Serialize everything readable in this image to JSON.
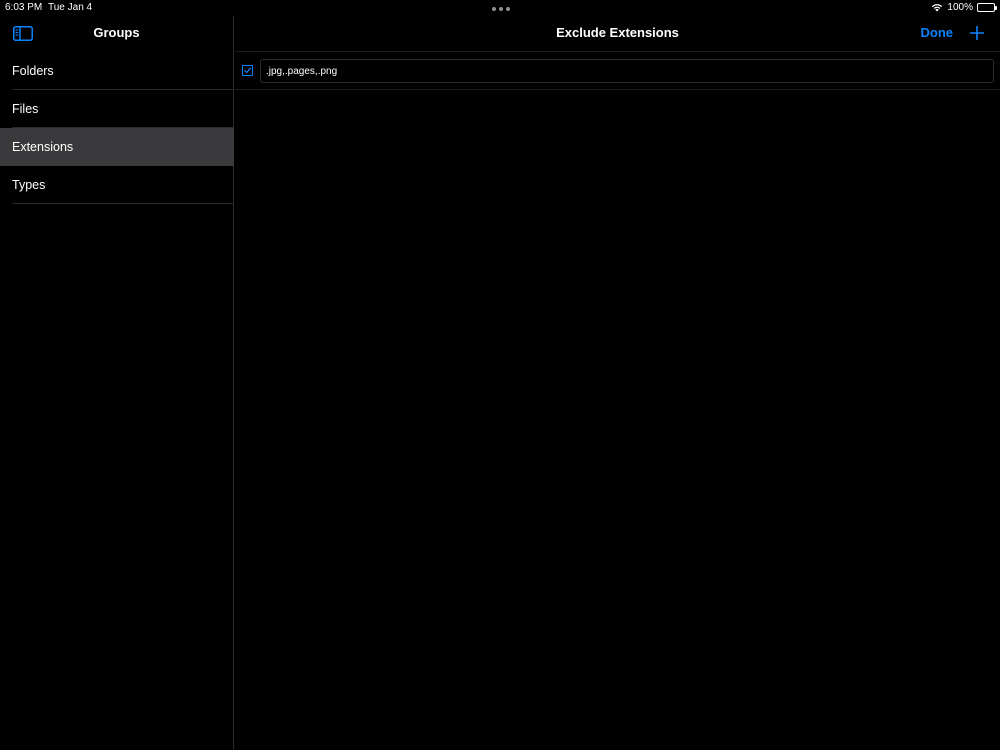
{
  "status_bar": {
    "time": "6:03 PM",
    "date": "Tue Jan 4",
    "battery": "100%",
    "battery_level": 1.0,
    "wifi_icon": "wifi-icon",
    "battery_icon": "battery-icon"
  },
  "sidebar": {
    "title": "Groups",
    "toggle_icon": "sidebar-toggle-icon",
    "selected_bg": "#3a3a3c",
    "items": [
      {
        "label": "Folders"
      },
      {
        "label": "Files"
      },
      {
        "label": "Extensions",
        "selected": true
      },
      {
        "label": "Types"
      }
    ]
  },
  "main": {
    "title": "Exclude Extensions",
    "done_label": "Done",
    "add_icon": "plus-icon",
    "accent_color": "#0a84ff",
    "rows": [
      {
        "checked": true,
        "value": ".jpg,.pages,.png"
      }
    ]
  }
}
